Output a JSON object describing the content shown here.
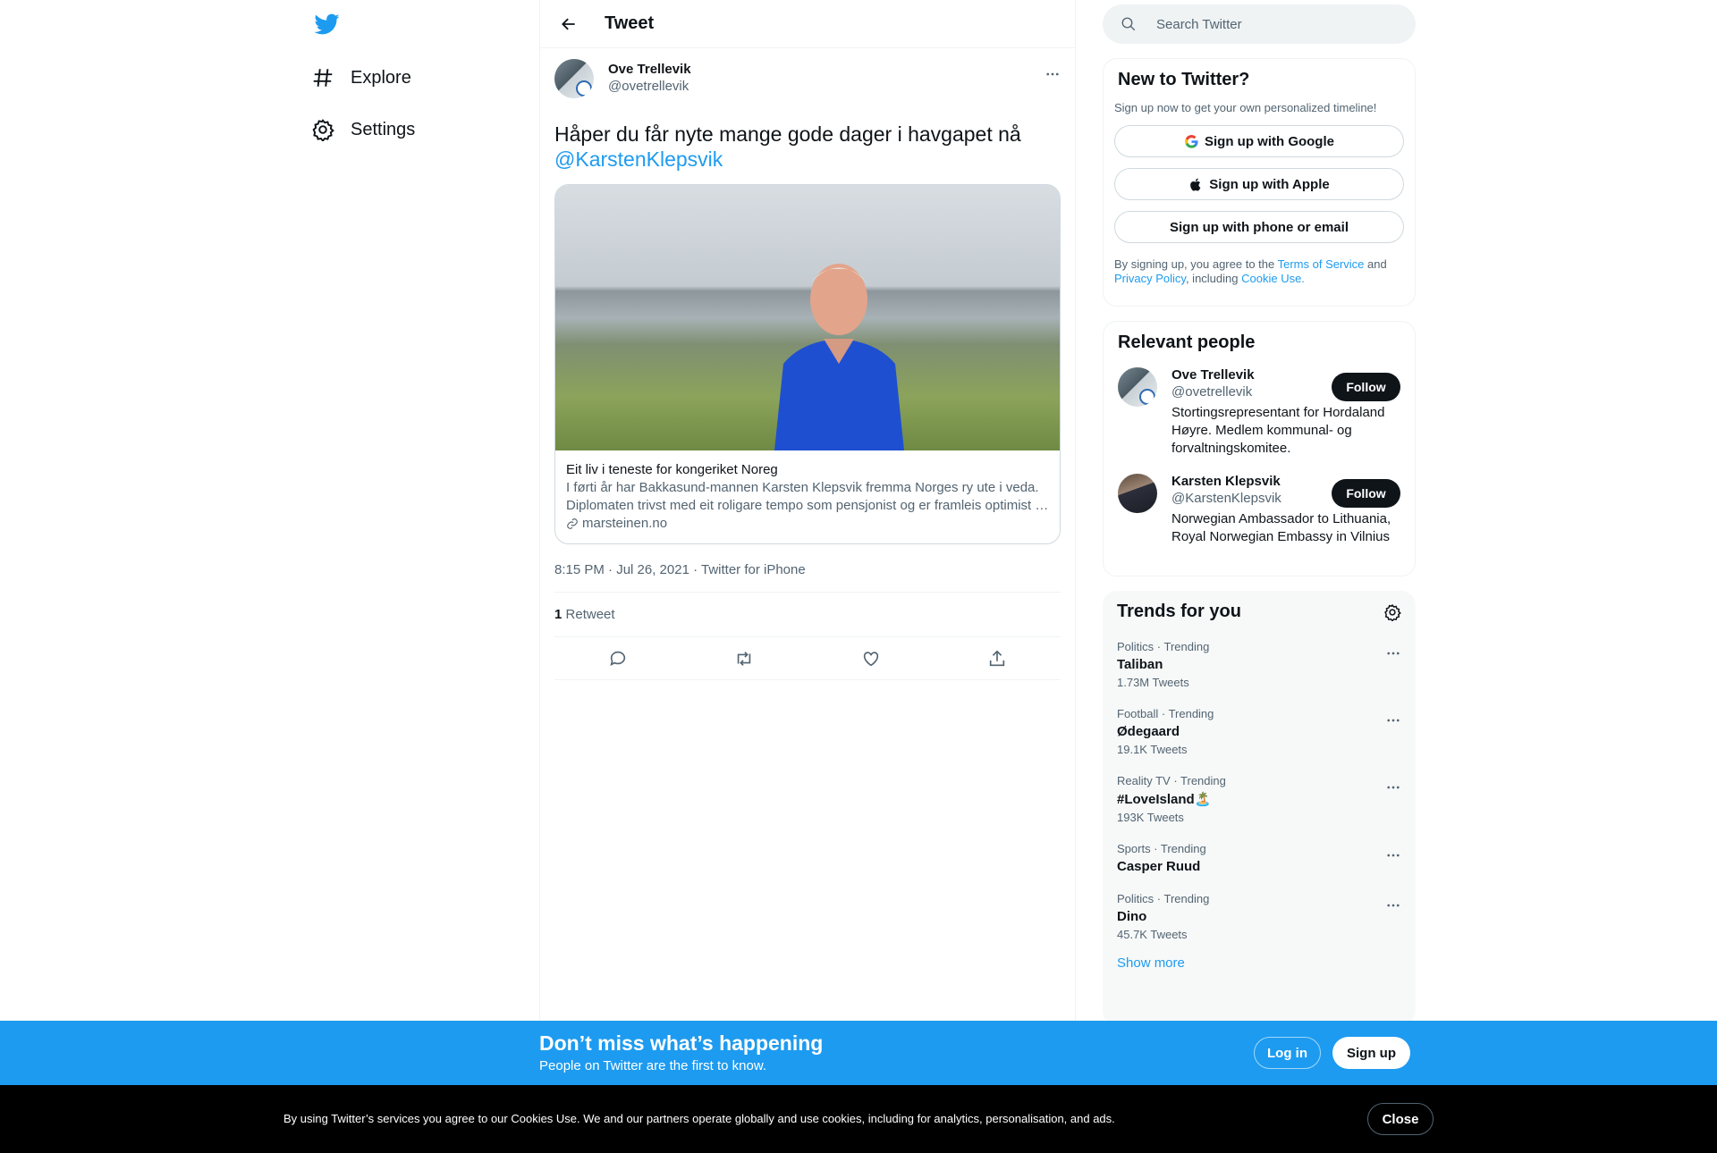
{
  "nav": {
    "explore_label": "Explore",
    "settings_label": "Settings"
  },
  "header": {
    "title": "Tweet"
  },
  "tweet": {
    "author_name": "Ove Trellevik",
    "author_handle": "@ovetrellevik",
    "text": "Håper du får nyte mange gode dager i havgapet nå",
    "mention": "@KarstenKlepsvik",
    "card": {
      "title": "Eit liv i teneste for kongeriket Noreg",
      "desc_line1": "I førti år har Bakkasund-mannen Karsten Klepsvik fremma Norges ry ute i veda.",
      "desc_line2": "Diplomaten trivst med eit roligare tempo som pensjonist og er framleis optimist …",
      "domain": "marsteinen.no"
    },
    "timestamp": "8:15 PM · Jul 26, 2021 · Twitter for iPhone",
    "retweet_count": "1",
    "retweet_label": "Retweet"
  },
  "search": {
    "placeholder": "Search Twitter"
  },
  "new_to_twitter": {
    "title": "New to Twitter?",
    "subtitle": "Sign up now to get your own personalized timeline!",
    "google_label": "Sign up with Google",
    "apple_label": "Sign up with Apple",
    "phone_label": "Sign up with phone or email",
    "legal_prefix": "By signing up, you agree to the ",
    "terms": "Terms of Service",
    "and": " and",
    "privacy": "Privacy Policy",
    "including": ", including ",
    "cookie": "Cookie Use."
  },
  "relevant_people": {
    "title": "Relevant people",
    "people": [
      {
        "name": "Ove Trellevik",
        "handle": "@ovetrellevik",
        "bio": "Stortingsrepresentant for Hordaland Høyre. Medlem kommunal- og forvaltningskomitee.",
        "follow": "Follow"
      },
      {
        "name": "Karsten Klepsvik",
        "handle": "@KarstenKlepsvik",
        "bio": "Norwegian Ambassador to Lithuania, Royal Norwegian Embassy in Vilnius",
        "follow": "Follow"
      }
    ]
  },
  "trends": {
    "title": "Trends for you",
    "items": [
      {
        "meta": "Politics · Trending",
        "name": "Taliban",
        "count": "1.73M Tweets"
      },
      {
        "meta": "Football · Trending",
        "name": "Ødegaard",
        "count": "19.1K Tweets"
      },
      {
        "meta": "Reality TV · Trending",
        "name": "#LoveIsland🏝️",
        "count": "193K Tweets"
      },
      {
        "meta": "Sports · Trending",
        "name": "Casper Ruud",
        "count": ""
      },
      {
        "meta": "Politics · Trending",
        "name": "Dino",
        "count": "45.7K Tweets"
      }
    ],
    "show_more": "Show more"
  },
  "bottom_bar": {
    "headline": "Don’t miss what’s happening",
    "subline": "People on Twitter are the first to know.",
    "login": "Log in",
    "signup": "Sign up"
  },
  "cookie_bar": {
    "text": "By using Twitter’s services you agree to our Cookies Use. We and our partners operate globally and use cookies, including for analytics, personalisation, and ads.",
    "close": "Close"
  },
  "colors": {
    "accent": "#1d9bf0",
    "text": "#0f1419",
    "secondary": "#536471",
    "cookie_bg": "#000000"
  }
}
